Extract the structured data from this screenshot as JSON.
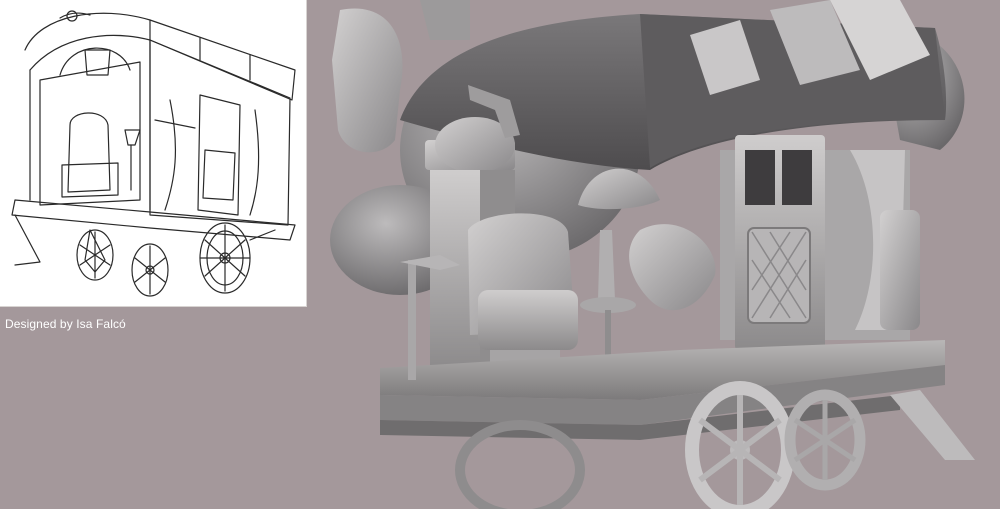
{
  "credit": {
    "text": "Designed by Isa Falcó"
  },
  "colors": {
    "background": "#a4989b",
    "sketch_panel": "#ffffff",
    "sketch_lines": "#2a2a2a",
    "sculpt_light": "#c4c2c2",
    "sculpt_mid": "#8e8c8d",
    "sculpt_dark": "#5c5a5c",
    "roof": "#6e6c6e"
  },
  "scene": {
    "left_image": "line-drawing concept sketch of a gypsy caravan wagon",
    "right_image": "grey clay 3D sculpt of the same caravan wagon with armchair, lamp, stove and door"
  }
}
